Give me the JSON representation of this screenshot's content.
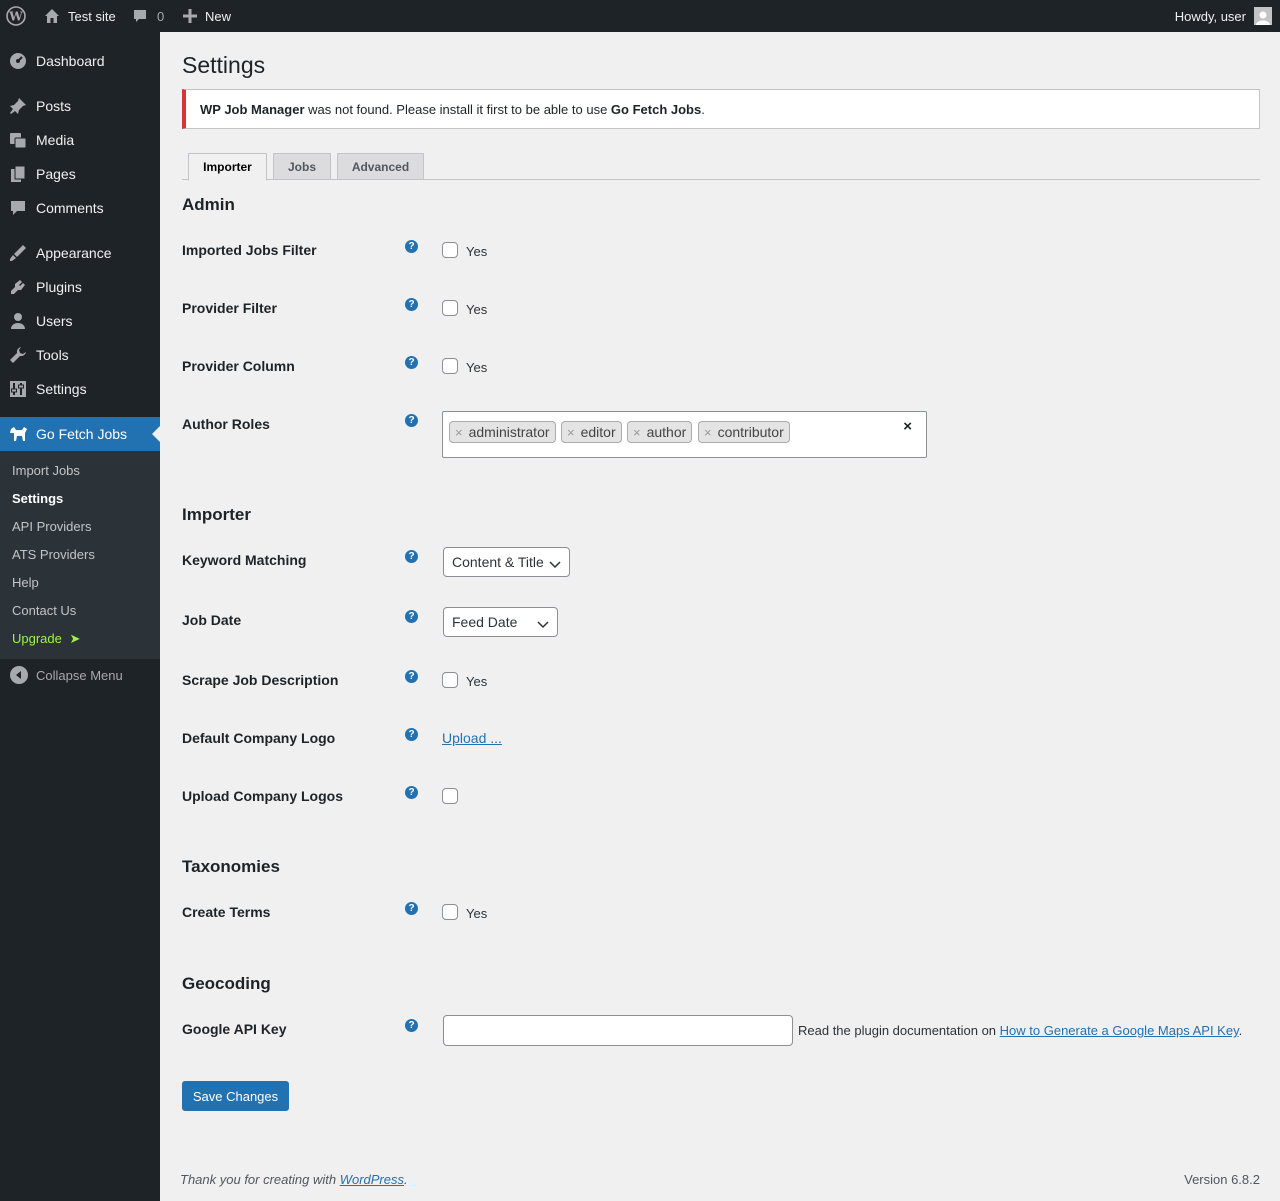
{
  "adminbar": {
    "site_name": "Test site",
    "comments_count": "0",
    "new_label": "New",
    "howdy": "Howdy, user"
  },
  "sidebar": {
    "items": [
      {
        "label": "Dashboard",
        "icon": "dashboard-icon"
      },
      {
        "label": "Posts",
        "icon": "pushpin-icon"
      },
      {
        "label": "Media",
        "icon": "media-icon"
      },
      {
        "label": "Pages",
        "icon": "pages-icon"
      },
      {
        "label": "Comments",
        "icon": "comment-icon"
      },
      {
        "label": "Appearance",
        "icon": "brush-icon"
      },
      {
        "label": "Plugins",
        "icon": "plug-icon"
      },
      {
        "label": "Users",
        "icon": "user-icon"
      },
      {
        "label": "Tools",
        "icon": "wrench-icon"
      },
      {
        "label": "Settings",
        "icon": "sliders-icon"
      },
      {
        "label": "Go Fetch Jobs",
        "icon": "dog-icon"
      }
    ],
    "submenu": [
      "Import Jobs",
      "Settings",
      "API Providers",
      "ATS Providers",
      "Help",
      "Contact Us",
      "Upgrade"
    ],
    "upgrade_arrow": "➤",
    "collapse_label": "Collapse Menu"
  },
  "page": {
    "title": "Settings",
    "notice": {
      "strong1": "WP Job Manager",
      "text": " was not found. Please install it first to be able to use ",
      "strong2": "Go Fetch Jobs",
      "end": "."
    },
    "tabs": [
      "Importer",
      "Jobs",
      "Advanced"
    ],
    "help_glyph": "?",
    "yes_label": "Yes",
    "sections": {
      "admin": "Admin",
      "importer": "Importer",
      "taxonomies": "Taxonomies",
      "geocoding": "Geocoding"
    },
    "rows": {
      "imported_jobs_filter": "Imported Jobs Filter",
      "provider_filter": "Provider Filter",
      "provider_column": "Provider Column",
      "author_roles": "Author Roles",
      "keyword_matching": "Keyword Matching",
      "job_date": "Job Date",
      "scrape_job_description": "Scrape Job Description",
      "default_company_logo": "Default Company Logo",
      "upload_company_logos": "Upload Company Logos",
      "create_terms": "Create Terms",
      "google_api_key": "Google API Key"
    },
    "author_roles": [
      "administrator",
      "editor",
      "author",
      "contributor"
    ],
    "chip_remove": "×",
    "clear_all": "×",
    "keyword_matching_value": "Content & Title",
    "job_date_value": "Feed Date",
    "upload_link": "Upload ...",
    "api_key_value": "",
    "api_desc_prefix": "Read the plugin documentation on ",
    "api_desc_link": "How to Generate a Google Maps API Key",
    "api_desc_suffix": ".",
    "save_label": "Save Changes"
  },
  "footer": {
    "thanks_prefix": "Thank you for creating with ",
    "wordpress_link": "WordPress",
    "thanks_suffix": ".",
    "version": "Version 6.8.2"
  },
  "colors": {
    "adminbar_bg": "#1d2327",
    "accent": "#2271b1",
    "error": "#d63638",
    "upgrade": "#9ff24b"
  }
}
